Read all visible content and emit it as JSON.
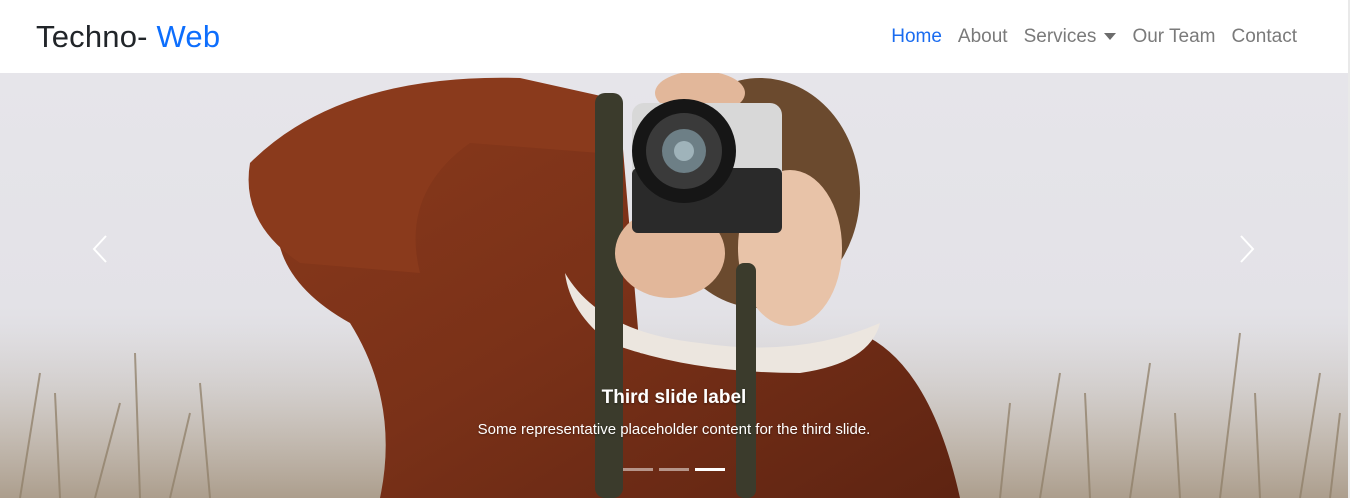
{
  "navbar": {
    "brand_main": "Techno-",
    "brand_accent": "Web",
    "items": [
      {
        "label": "Home"
      },
      {
        "label": "About"
      },
      {
        "label": "Services"
      },
      {
        "label": "Our Team"
      },
      {
        "label": "Contact"
      }
    ],
    "active_item": "Home"
  },
  "carousel": {
    "caption_title": "Third slide label",
    "caption_text": "Some representative placeholder content for the third slide.",
    "slide_count": 3,
    "active_slide": 3
  },
  "colors": {
    "accent": "#0d6efd",
    "nav_text": "#7a7a7a",
    "brand_text": "#212529"
  }
}
